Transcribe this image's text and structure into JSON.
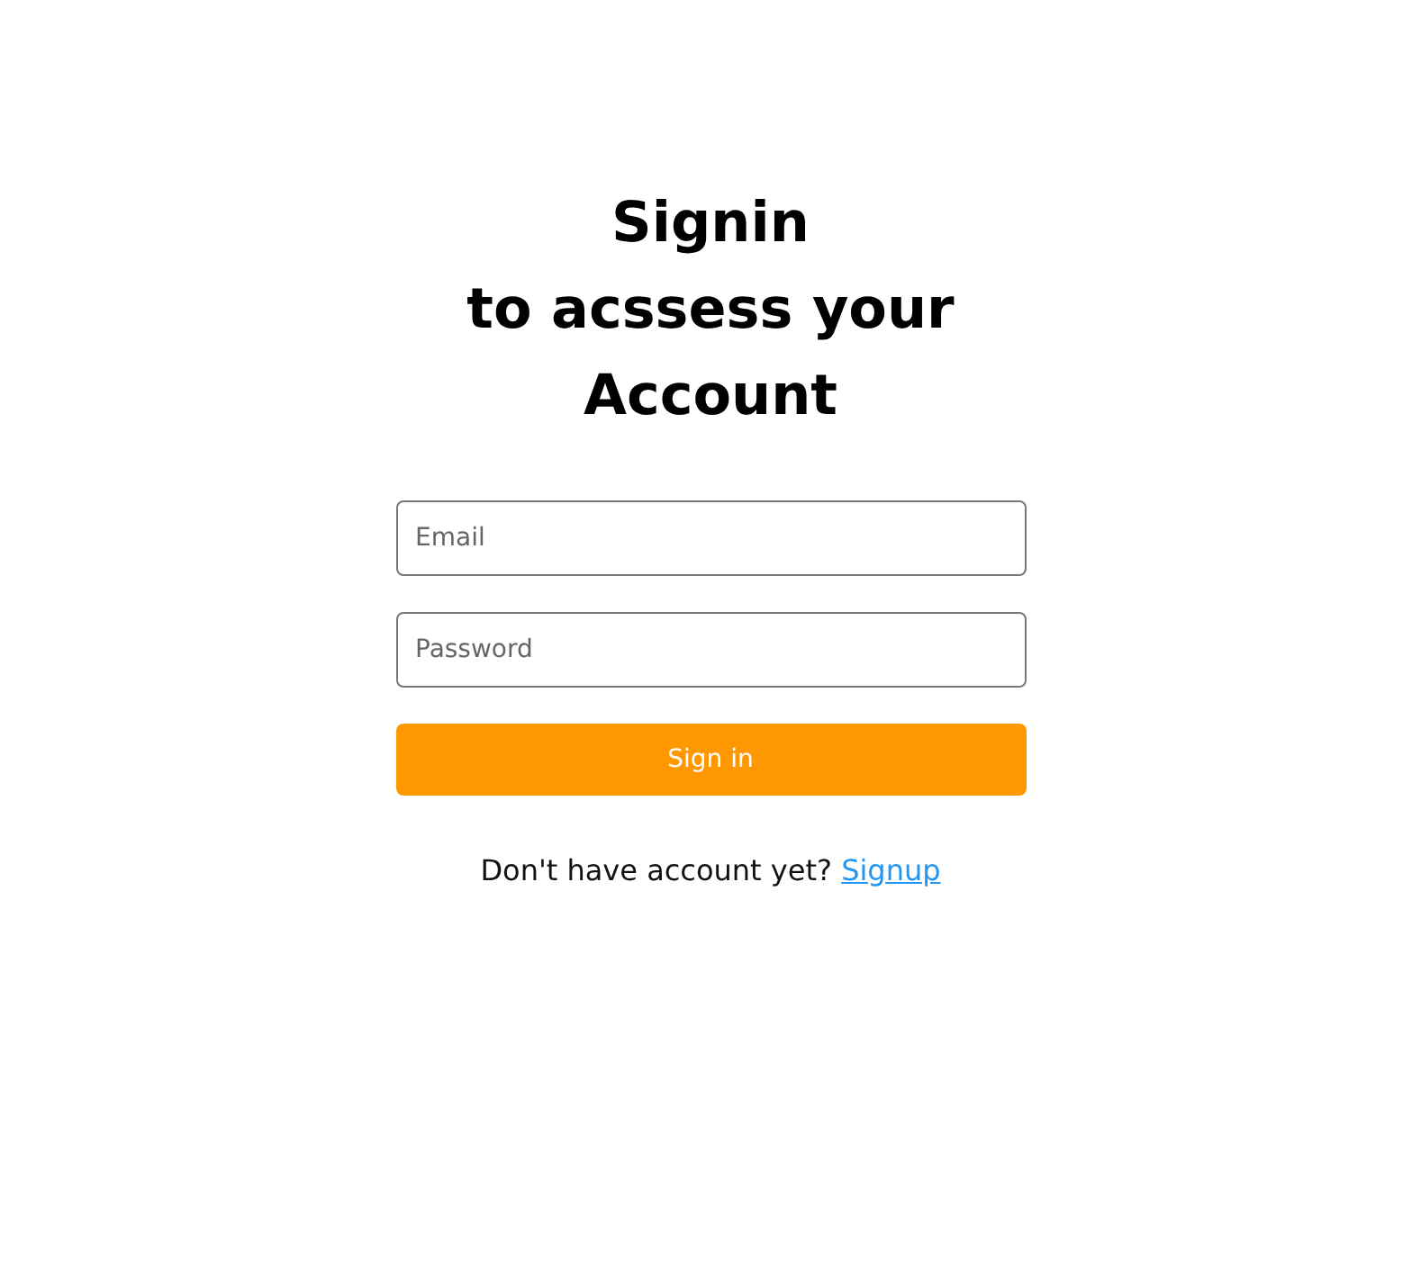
{
  "heading": [
    "Signin",
    "to acssess your",
    "Account"
  ],
  "fields": [
    {
      "placeholder": "Email"
    },
    {
      "placeholder": "Password"
    }
  ],
  "submit": "Sign in",
  "footer": {
    "text": "Don't have account yet?",
    "link": "Signup"
  }
}
